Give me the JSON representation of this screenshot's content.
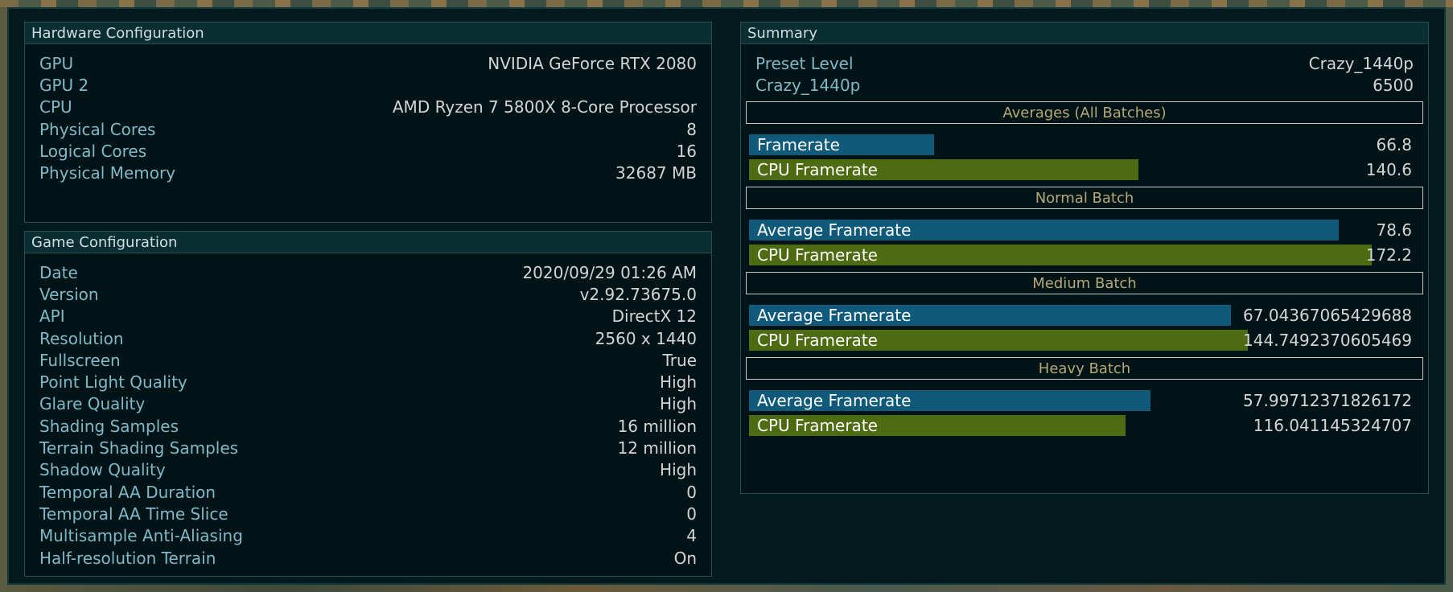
{
  "hardware": {
    "title": "Hardware Configuration",
    "rows": [
      {
        "label": "GPU",
        "value": "NVIDIA GeForce RTX 2080"
      },
      {
        "label": "GPU 2",
        "value": ""
      },
      {
        "label": "CPU",
        "value": "AMD Ryzen 7 5800X 8-Core Processor"
      },
      {
        "label": "Physical Cores",
        "value": "8"
      },
      {
        "label": "Logical Cores",
        "value": "16"
      },
      {
        "label": "Physical Memory",
        "value": "32687 MB"
      }
    ]
  },
  "game": {
    "title": "Game Configuration",
    "rows": [
      {
        "label": "Date",
        "value": "2020/09/29 01:26 AM"
      },
      {
        "label": "Version",
        "value": "v2.92.73675.0"
      },
      {
        "label": "API",
        "value": "DirectX 12"
      },
      {
        "label": "Resolution",
        "value": "2560 x 1440"
      },
      {
        "label": "Fullscreen",
        "value": "True"
      },
      {
        "label": "Point Light Quality",
        "value": "High"
      },
      {
        "label": "Glare Quality",
        "value": "High"
      },
      {
        "label": "Shading Samples",
        "value": "16 million"
      },
      {
        "label": "Terrain Shading Samples",
        "value": "12 million"
      },
      {
        "label": "Shadow Quality",
        "value": "High"
      },
      {
        "label": "Temporal AA Duration",
        "value": "0"
      },
      {
        "label": "Temporal AA Time Slice",
        "value": "0"
      },
      {
        "label": "Multisample Anti-Aliasing",
        "value": "4"
      },
      {
        "label": "Half-resolution Terrain",
        "value": "On"
      }
    ]
  },
  "summary": {
    "title": "Summary",
    "rows": [
      {
        "label": "Preset Level",
        "value": "Crazy_1440p"
      },
      {
        "label": "Crazy_1440p",
        "value": "6500"
      }
    ],
    "bar_max": 240,
    "colors": {
      "framerate": "#0f5a7a",
      "cpu": "#4d6b10"
    },
    "sections": [
      {
        "title": "Averages (All Batches)",
        "bars": [
          {
            "label": "Framerate",
            "value": "66.8",
            "fill": 66.8,
            "kind": "blue"
          },
          {
            "label": "CPU Framerate",
            "value": "140.6",
            "fill": 140.6,
            "kind": "green"
          }
        ]
      },
      {
        "title": "Normal Batch",
        "bars": [
          {
            "label": "Average Framerate",
            "value": "78.6",
            "fill": 213,
            "kind": "blue"
          },
          {
            "label": "CPU Framerate",
            "value": "172.2",
            "fill": 225,
            "kind": "green"
          }
        ]
      },
      {
        "title": "Medium Batch",
        "bars": [
          {
            "label": "Average Framerate",
            "value": "67.04367065429688",
            "fill": 174,
            "kind": "blue"
          },
          {
            "label": "CPU Framerate",
            "value": "144.7492370605469",
            "fill": 180,
            "kind": "green"
          }
        ]
      },
      {
        "title": "Heavy Batch",
        "bars": [
          {
            "label": "Average Framerate",
            "value": "57.99712371826172",
            "fill": 145,
            "kind": "blue"
          },
          {
            "label": "CPU Framerate",
            "value": "116.041145324707",
            "fill": 136,
            "kind": "green"
          }
        ]
      }
    ]
  }
}
